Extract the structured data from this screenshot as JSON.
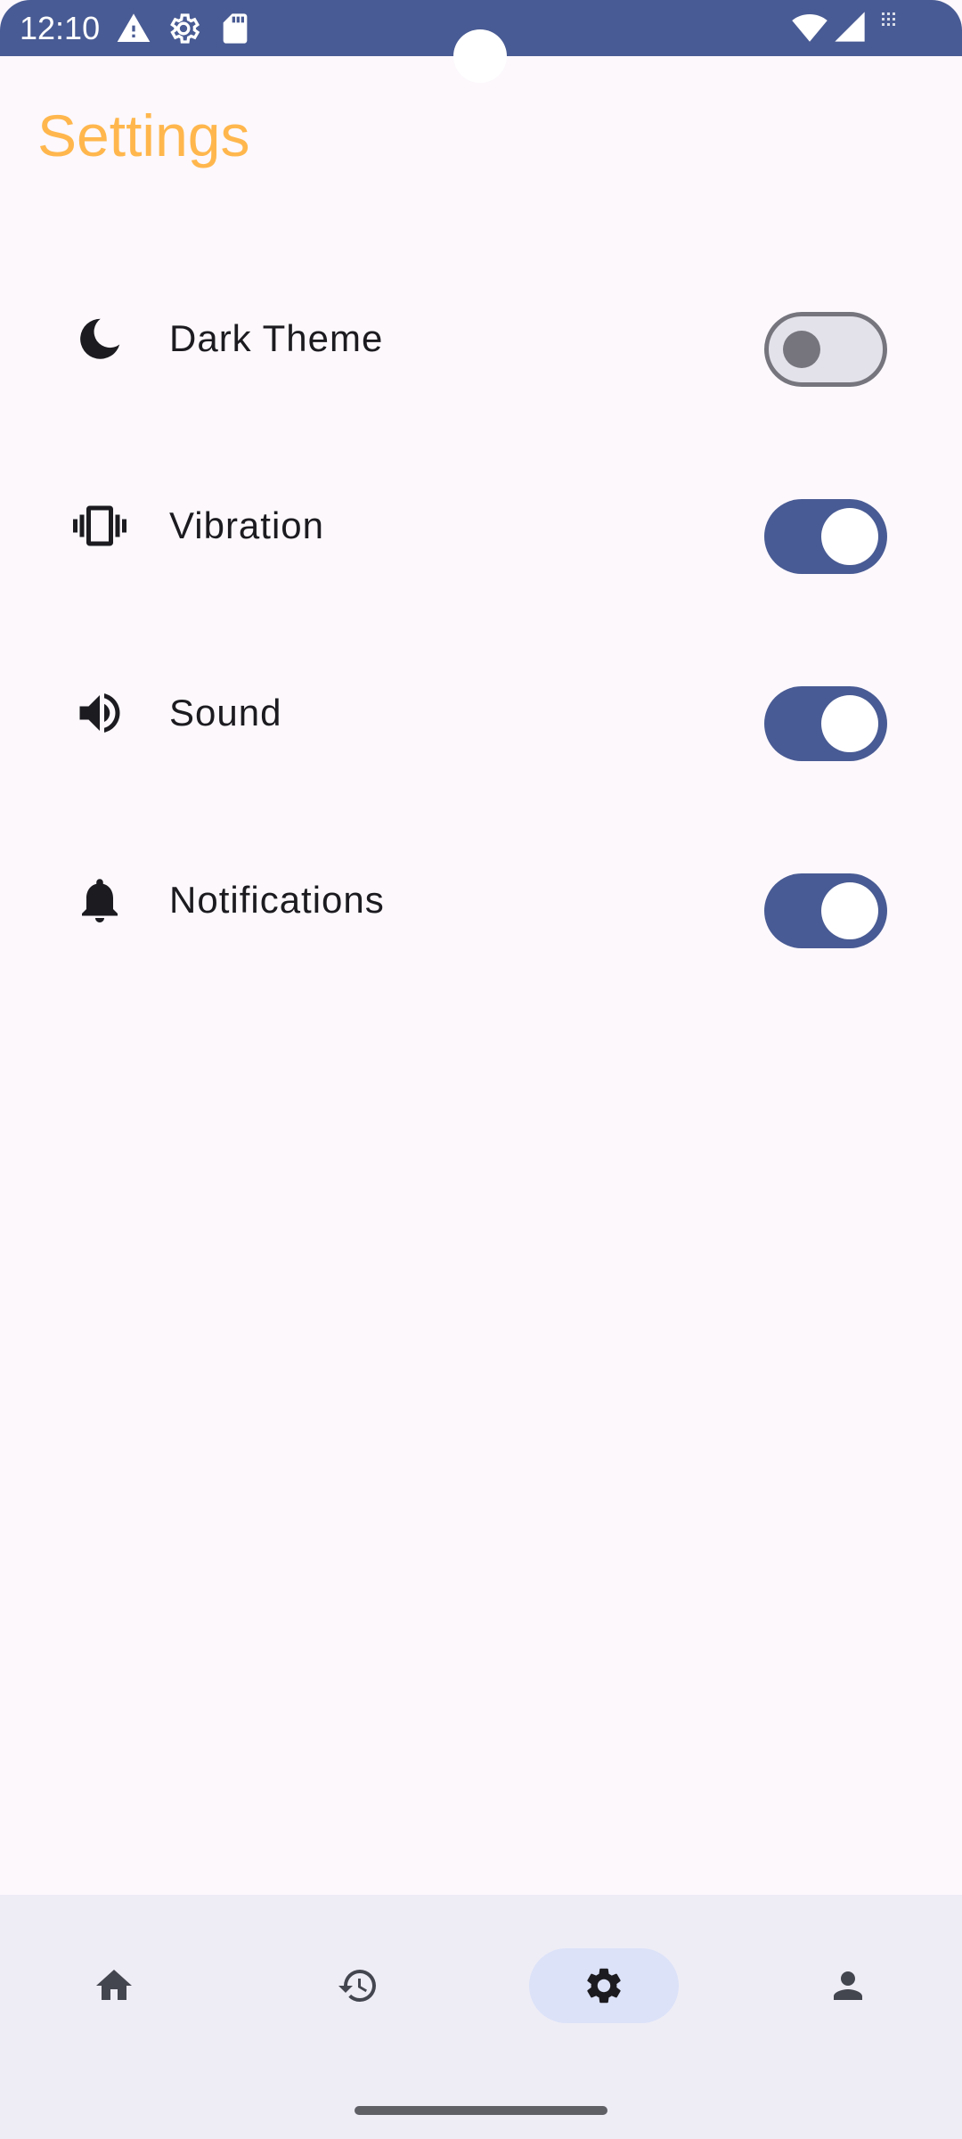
{
  "status_bar": {
    "time": "12:10",
    "background": "#495b94",
    "left_icons": [
      "warning-icon",
      "gear-icon",
      "sd-card-icon"
    ],
    "right_icons": [
      "wifi-icon",
      "signal-icon",
      "no-sim-icon"
    ]
  },
  "header": {
    "title": "Settings",
    "title_color": "#ffb74d"
  },
  "settings": [
    {
      "icon": "moon-icon",
      "label": "Dark Theme",
      "enabled": false
    },
    {
      "icon": "vibration-icon",
      "label": "Vibration",
      "enabled": true
    },
    {
      "icon": "volume-icon",
      "label": "Sound",
      "enabled": true
    },
    {
      "icon": "bell-icon",
      "label": "Notifications",
      "enabled": true
    }
  ],
  "bottom_nav": {
    "items": [
      {
        "icon": "home-icon",
        "active": false
      },
      {
        "icon": "history-icon",
        "active": false
      },
      {
        "icon": "gear-icon",
        "active": true
      },
      {
        "icon": "person-icon",
        "active": false
      }
    ]
  },
  "colors": {
    "accent": "#495b94",
    "background": "#fcf8fc",
    "nav_background": "#eeedf6",
    "nav_active_pill": "#dce2f8"
  }
}
